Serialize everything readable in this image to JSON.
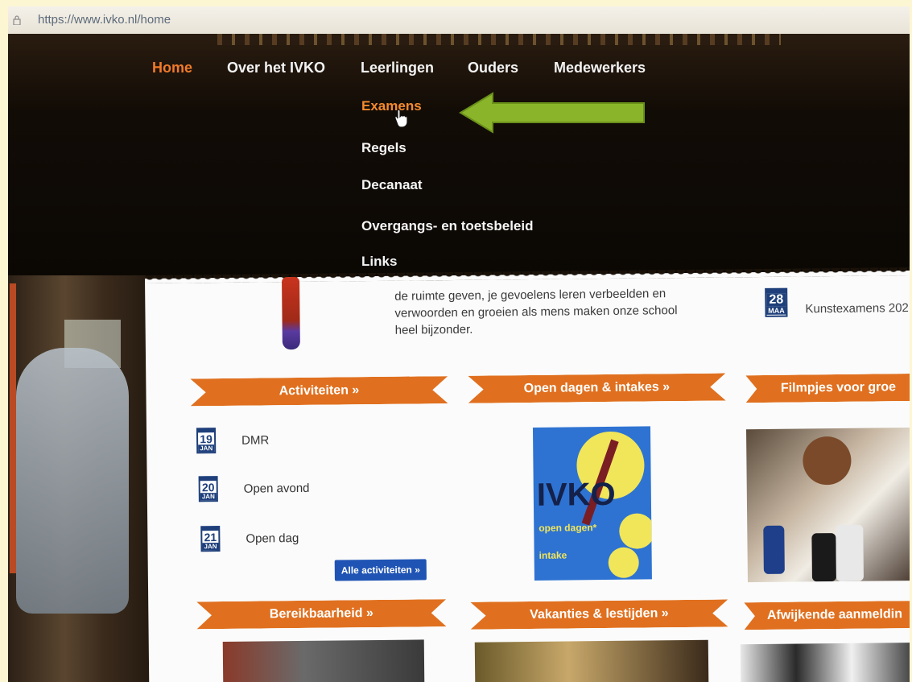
{
  "browser": {
    "url": "https://www.ivko.nl/home"
  },
  "nav": {
    "items": [
      "Home",
      "Over het IVKO",
      "Leerlingen",
      "Ouders",
      "Medewerkers"
    ],
    "active_color": "#f07a2a"
  },
  "submenu": {
    "items": [
      "Examens",
      "Regels",
      "Decanaat",
      "Overgangs- en toetsbeleid",
      "Links"
    ],
    "highlight_color": "#f58a2e"
  },
  "intro": {
    "lines": [
      "de ruimte geven, je gevoelens leren verbeelden en",
      "verwoorden en groeien als mens maken onze school",
      "heel bijzonder."
    ]
  },
  "upcoming": {
    "day": "28",
    "month": "MAA",
    "label": "Kunstexamens 202"
  },
  "sections": {
    "activiteiten": "Activiteiten »",
    "open_dagen": "Open dagen & intakes »",
    "filmpjes": "Filmpjes voor groe",
    "bereikbaarheid": "Bereikbaarheid »",
    "vakanties": "Vakanties & lestijden »",
    "afwijkende": "Afwijkende aanmeldin"
  },
  "activities": [
    {
      "day": "19",
      "month": "JAN",
      "label": "DMR"
    },
    {
      "day": "20",
      "month": "JAN",
      "label": "Open avond"
    },
    {
      "day": "21",
      "month": "JAN",
      "label": "Open dag"
    }
  ],
  "all_activities_button": "Alle activiteiten »",
  "poster": {
    "title": "IVKO",
    "open": "open dagen*",
    "intake": "intake"
  },
  "colors": {
    "ribbon": "#e0701f",
    "calendar": "#1e3f7a",
    "button": "#1f54b4",
    "arrow": "#8ab52a"
  }
}
